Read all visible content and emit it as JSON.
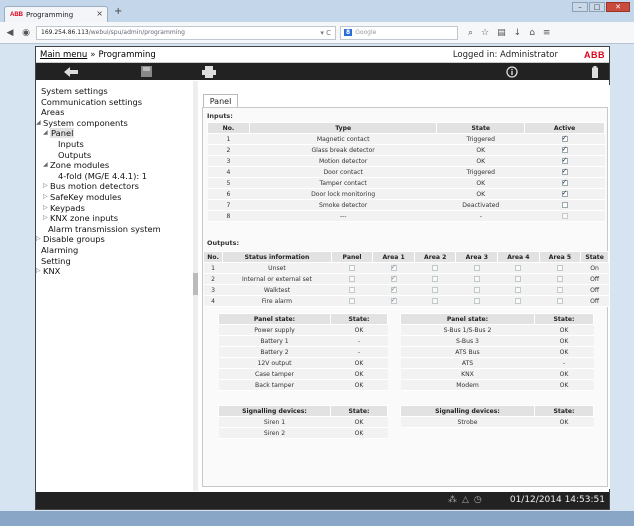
{
  "browser": {
    "tab_title": "Programming",
    "tab_close": "×",
    "new_tab": "+",
    "abb_small": "ABB",
    "url_host": "169.254.86.113",
    "url_path": "/webui/spu/admin/programming",
    "url_controls": "▾ C",
    "search_engine_badge": "8",
    "search_placeholder": "Google",
    "window_min": "–",
    "window_max": "□",
    "window_close": "✕"
  },
  "header": {
    "breadcrumb_main": "Main menu",
    "breadcrumb_sep": "»",
    "breadcrumb_page": "Programming",
    "logged_in": "Logged in: Administrator",
    "logo": "ABB"
  },
  "sidebar": {
    "items": [
      {
        "label": "System settings",
        "level": 0,
        "twisty": ""
      },
      {
        "label": "Communication settings",
        "level": 0,
        "twisty": ""
      },
      {
        "label": "Areas",
        "level": 0,
        "twisty": ""
      },
      {
        "label": "System components",
        "level": 0,
        "twisty": "◢"
      },
      {
        "label": "Panel",
        "level": 1,
        "twisty": "◢",
        "selected": true
      },
      {
        "label": "Inputs",
        "level": 2,
        "twisty": ""
      },
      {
        "label": "Outputs",
        "level": 2,
        "twisty": ""
      },
      {
        "label": "Zone modules",
        "level": 1,
        "twisty": "◢"
      },
      {
        "label": "4-fold (MG/E 4.4.1): 1",
        "level": 2,
        "twisty": ""
      },
      {
        "label": "Bus motion detectors",
        "level": 1,
        "twisty": "▷"
      },
      {
        "label": "SafeKey modules",
        "level": 1,
        "twisty": "▷"
      },
      {
        "label": "Keypads",
        "level": 1,
        "twisty": "▷"
      },
      {
        "label": "KNX zone inputs",
        "level": 1,
        "twisty": "▷"
      },
      {
        "label": "Alarm transmission system",
        "level": 1,
        "twisty": ""
      },
      {
        "label": "Disable groups",
        "level": 0,
        "twisty": "▷"
      },
      {
        "label": "Alarming",
        "level": 0,
        "twisty": ""
      },
      {
        "label": "Setting",
        "level": 0,
        "twisty": ""
      },
      {
        "label": "KNX",
        "level": 0,
        "twisty": "▷"
      }
    ]
  },
  "panel_tab": "Panel",
  "inputs": {
    "title": "Inputs:",
    "headers": [
      "No.",
      "Type",
      "State",
      "Active"
    ],
    "rows": [
      {
        "no": "1",
        "type": "Magnetic contact",
        "state": "Triggered",
        "active": true
      },
      {
        "no": "2",
        "type": "Glass break detector",
        "state": "OK",
        "active": true
      },
      {
        "no": "3",
        "type": "Motion detector",
        "state": "OK",
        "active": true
      },
      {
        "no": "4",
        "type": "Door contact",
        "state": "Triggered",
        "active": true
      },
      {
        "no": "5",
        "type": "Tamper contact",
        "state": "OK",
        "active": true
      },
      {
        "no": "6",
        "type": "Door lock monitoring",
        "state": "OK",
        "active": true
      },
      {
        "no": "7",
        "type": "Smoke detector",
        "state": "Deactivated",
        "active": false
      },
      {
        "no": "8",
        "type": "---",
        "state": "-",
        "active": false
      }
    ]
  },
  "outputs": {
    "title": "Outputs:",
    "headers": [
      "No.",
      "Status information",
      "Panel",
      "Area 1",
      "Area 2",
      "Area 3",
      "Area 4",
      "Area 5",
      "State"
    ],
    "rows": [
      {
        "no": "1",
        "info": "Unset",
        "checks": [
          false,
          true,
          false,
          false,
          false,
          false
        ],
        "state": "On"
      },
      {
        "no": "2",
        "info": "Internal or external set",
        "checks": [
          false,
          true,
          false,
          false,
          false,
          false
        ],
        "state": "Off"
      },
      {
        "no": "3",
        "info": "Walktest",
        "checks": [
          false,
          true,
          false,
          false,
          false,
          false
        ],
        "state": "Off"
      },
      {
        "no": "4",
        "info": "Fire alarm",
        "checks": [
          false,
          true,
          false,
          false,
          false,
          false
        ],
        "state": "Off"
      }
    ]
  },
  "panel_state_left": {
    "headers": [
      "Panel state:",
      "State:"
    ],
    "rows": [
      [
        "Power supply",
        "OK"
      ],
      [
        "Battery 1",
        "-"
      ],
      [
        "Battery 2",
        "-"
      ],
      [
        "12V output",
        "OK"
      ],
      [
        "Case tamper",
        "OK"
      ],
      [
        "Back tamper",
        "OK"
      ]
    ]
  },
  "panel_state_right": {
    "headers": [
      "Panel state:",
      "State:"
    ],
    "rows": [
      [
        "S-Bus 1/S-Bus 2",
        "OK"
      ],
      [
        "S-Bus 3",
        "OK"
      ],
      [
        "ATS Bus",
        "OK"
      ],
      [
        "ATS",
        "-"
      ],
      [
        "KNX",
        "OK"
      ],
      [
        "Modem",
        "OK"
      ]
    ]
  },
  "signalling_left": {
    "headers": [
      "Signalling devices:",
      "State:"
    ],
    "rows": [
      [
        "Siren 1",
        "OK"
      ],
      [
        "Siren 2",
        "OK"
      ]
    ]
  },
  "signalling_right": {
    "headers": [
      "Signalling devices:",
      "State:"
    ],
    "rows": [
      [
        "Strobe",
        "OK"
      ]
    ]
  },
  "footer": {
    "datetime": "01/12/2014 14:53:51"
  }
}
